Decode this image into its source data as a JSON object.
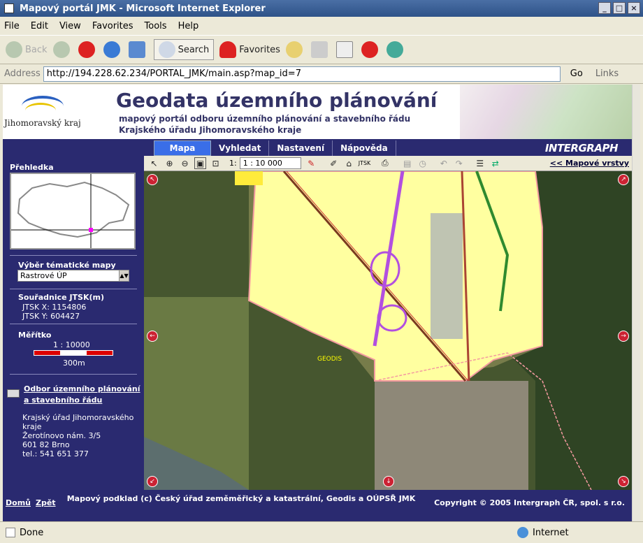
{
  "window": {
    "title": "Mapový portál JMK - Microsoft Internet Explorer"
  },
  "menu": [
    "File",
    "Edit",
    "View",
    "Favorites",
    "Tools",
    "Help"
  ],
  "toolbar": {
    "back": "Back",
    "search": "Search",
    "favorites": "Favorites"
  },
  "address": {
    "label": "Address",
    "url": "http://194.228.62.234/PORTAL_JMK/main.asp?map_id=7",
    "go": "Go",
    "links": "Links"
  },
  "header": {
    "logo_text": "Jihomoravský kraj",
    "title": "Geodata územního plánování",
    "subtitle1": "mapový portál odboru územního plánování a stavebního řádu",
    "subtitle2": "Krajského úřadu Jihomoravského kraje",
    "brand": "INTERGRAPH"
  },
  "nav": [
    "Mapa",
    "Vyhledat",
    "Nastavení",
    "Nápověda"
  ],
  "sidebar": {
    "overview_title": "Přehledka",
    "theme_label": "Výběr tématické mapy",
    "theme_value": "Rastrové ÚP",
    "coords_title": "Souřadnice JTSK(m)",
    "jtsk_x": "JTSK X: 1154806",
    "jtsk_y": "JTSK Y: 604427",
    "scale_title": "Měřítko",
    "scale_value": "1 : 10000",
    "scale_len": "300m",
    "contact_link": "Odbor územního plánování a stavebního řádu",
    "addr1": "Krajský úřad Jihomoravského",
    "addr2": "kraje",
    "addr3": "Žerotínovo nám. 3/5",
    "addr4": "601 82 Brno",
    "addr5": "tel.: 541 651 377"
  },
  "maptools": {
    "scale_prefix": "1:",
    "scale_value": "1 : 10 000",
    "jtsk": "JTSK",
    "layers": "<< Mapové vrstvy"
  },
  "map": {
    "label_geodis": "GEODIS"
  },
  "footer": {
    "home": "Domů",
    "back": "Zpět",
    "source": "Mapový podklad (c) Český úřad zeměměřický a katastrální, Geodis a OÚPSŘ JMK",
    "copyright": "Copyright © 2005 Intergraph ČR, spol. s r.o."
  },
  "status": {
    "left": "Done",
    "right": "Internet"
  }
}
